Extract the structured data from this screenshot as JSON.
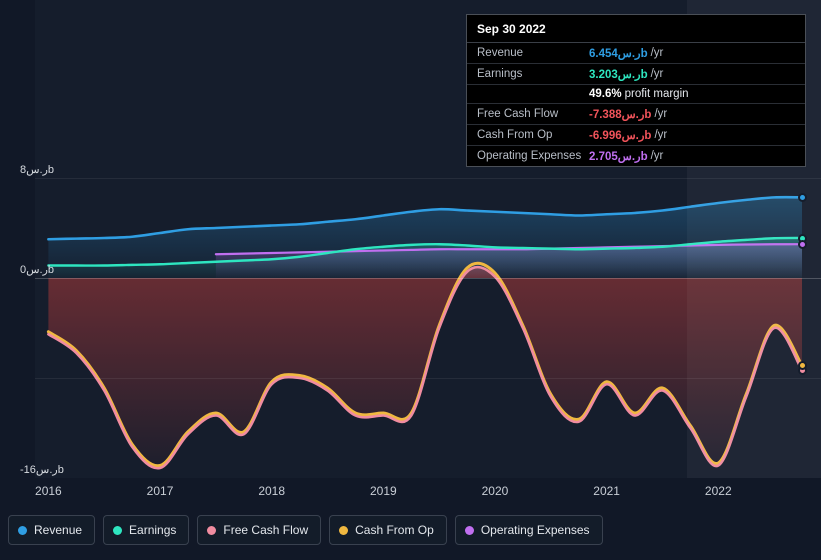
{
  "chart_data": {
    "type": "area",
    "title": "",
    "xlabel": "",
    "ylabel": "",
    "currency_suffix": "ر.سb",
    "ylim": [
      -16,
      8
    ],
    "yticks": [
      {
        "value": 8,
        "label": "8ر.سb"
      },
      {
        "value": 0,
        "label": "0ر.سb"
      },
      {
        "value": -16,
        "label": "-16ر.سb"
      }
    ],
    "xticks": [
      "2016",
      "2017",
      "2018",
      "2019",
      "2020",
      "2021",
      "2022"
    ],
    "grid": true,
    "legend_position": "bottom",
    "x": [
      2016.0,
      2016.25,
      2016.5,
      2016.75,
      2017.0,
      2017.25,
      2017.5,
      2017.75,
      2018.0,
      2018.25,
      2018.5,
      2018.75,
      2019.0,
      2019.25,
      2019.5,
      2019.75,
      2020.0,
      2020.25,
      2020.5,
      2020.75,
      2021.0,
      2021.25,
      2021.5,
      2021.75,
      2022.0,
      2022.25,
      2022.5,
      2022.75
    ],
    "series": [
      {
        "name": "Revenue",
        "color": "#2f9ee3",
        "values": [
          3.1,
          3.15,
          3.2,
          3.3,
          3.6,
          3.9,
          4.0,
          4.1,
          4.2,
          4.3,
          4.5,
          4.7,
          5.0,
          5.3,
          5.5,
          5.4,
          5.3,
          5.2,
          5.1,
          5.0,
          5.1,
          5.2,
          5.4,
          5.7,
          6.0,
          6.25,
          6.45,
          6.454
        ]
      },
      {
        "name": "Earnings",
        "color": "#2ee6c0",
        "values": [
          1.0,
          1.0,
          1.0,
          1.05,
          1.1,
          1.2,
          1.3,
          1.4,
          1.5,
          1.7,
          2.0,
          2.3,
          2.5,
          2.65,
          2.7,
          2.6,
          2.45,
          2.4,
          2.35,
          2.3,
          2.35,
          2.4,
          2.5,
          2.7,
          2.9,
          3.05,
          3.18,
          3.203
        ]
      },
      {
        "name": "Free Cash Flow",
        "color": "#f08ca0",
        "values": [
          -4.5,
          -6.0,
          -9.0,
          -13.5,
          -15.2,
          -12.5,
          -11.0,
          -12.5,
          -8.5,
          -8.0,
          -9.0,
          -11.0,
          -11.0,
          -11.0,
          -4.0,
          0.5,
          0.1,
          -4.0,
          -9.5,
          -11.5,
          -8.5,
          -11.0,
          -9.0,
          -12.0,
          -15.0,
          -9.5,
          -4.0,
          -7.388
        ]
      },
      {
        "name": "Cash From Op",
        "color": "#f0b840",
        "values": [
          -4.3,
          -5.8,
          -8.8,
          -13.3,
          -15.0,
          -12.3,
          -10.8,
          -12.3,
          -8.3,
          -7.8,
          -8.8,
          -10.8,
          -10.8,
          -10.8,
          -3.8,
          0.8,
          0.4,
          -3.8,
          -9.3,
          -11.3,
          -8.3,
          -10.8,
          -8.8,
          -11.8,
          -14.8,
          -9.3,
          -3.8,
          -6.996
        ]
      },
      {
        "name": "Operating Expenses",
        "color": "#c06ff0",
        "values": [
          null,
          null,
          null,
          null,
          null,
          null,
          1.9,
          1.95,
          2.0,
          2.05,
          2.1,
          2.15,
          2.2,
          2.25,
          2.3,
          2.3,
          2.3,
          2.3,
          2.35,
          2.4,
          2.45,
          2.5,
          2.55,
          2.6,
          2.65,
          2.68,
          2.7,
          2.705
        ]
      }
    ]
  },
  "tooltip": {
    "title": "Sep 30 2022",
    "rows": [
      {
        "label": "Revenue",
        "value": "6.454ر.سb",
        "suffix": "/yr",
        "color": "#2f9ee3",
        "note": ""
      },
      {
        "label": "Earnings",
        "value": "3.203ر.سb",
        "suffix": "/yr",
        "color": "#2ee6c0",
        "note": ""
      },
      {
        "label": "",
        "value": "49.6%",
        "suffix": "",
        "color": "#ffffff",
        "note": "profit margin"
      },
      {
        "label": "Free Cash Flow",
        "value": "-7.388ر.سb",
        "suffix": "/yr",
        "color": "#f2545b",
        "note": ""
      },
      {
        "label": "Cash From Op",
        "value": "-6.996ر.سb",
        "suffix": "/yr",
        "color": "#f2545b",
        "note": ""
      },
      {
        "label": "Operating Expenses",
        "value": "2.705ر.سb",
        "suffix": "/yr",
        "color": "#c06ff0",
        "note": ""
      }
    ]
  },
  "legend": {
    "items": [
      {
        "label": "Revenue",
        "color": "#2f9ee3"
      },
      {
        "label": "Earnings",
        "color": "#2ee6c0"
      },
      {
        "label": "Free Cash Flow",
        "color": "#f08ca0"
      },
      {
        "label": "Cash From Op",
        "color": "#f0b840"
      },
      {
        "label": "Operating Expenses",
        "color": "#c06ff0"
      }
    ]
  }
}
